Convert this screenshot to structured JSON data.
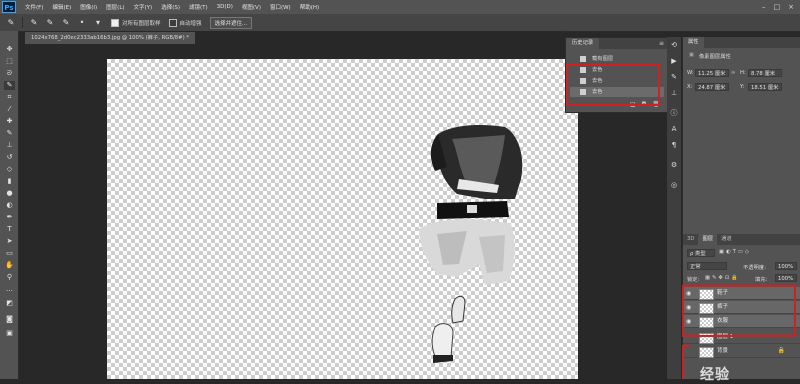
{
  "menubar": {
    "logo": "Ps",
    "items": [
      "文件(F)",
      "编辑(E)",
      "图像(I)",
      "图层(L)",
      "文字(Y)",
      "选择(S)",
      "滤镜(T)",
      "3D(D)",
      "视图(V)",
      "窗口(W)",
      "帮助(H)"
    ],
    "win_controls": [
      "–",
      "□",
      "×"
    ]
  },
  "options": {
    "sample_all_layers": "对所有图层取样",
    "auto_enhance": "自动增强",
    "select_subject": "选择并遮住..."
  },
  "document": {
    "tab_title": "1024x768_2d0ec2333ab16b3.jpg @ 100% (裤子, RGB/8#) *"
  },
  "history": {
    "title": "历史记录",
    "items": [
      {
        "label": "载有图层",
        "active": false
      },
      {
        "label": "去色",
        "active": false
      },
      {
        "label": "去色",
        "active": false
      },
      {
        "label": "去色",
        "active": true
      }
    ],
    "footer_icons": [
      "⬓",
      "◘",
      "🗑"
    ]
  },
  "properties": {
    "title": "属性",
    "subtitle": "像素图层属性",
    "w_label": "W:",
    "w_value": "11.25 厘米",
    "h_label": "H:",
    "h_value": "8.78 厘米",
    "x_label": "X:",
    "x_value": "24.87 厘米",
    "y_label": "Y:",
    "y_value": "18.51 厘米"
  },
  "layers": {
    "tabs": [
      "3D",
      "图层",
      "通道"
    ],
    "filter_label": "ρ 类型",
    "blend_mode": "正常",
    "opacity_label": "不透明度:",
    "opacity_value": "100%",
    "lock_label": "锁定:",
    "fill_label": "填充:",
    "fill_value": "100%",
    "items": [
      {
        "name": "鞋子",
        "visible": true,
        "selected": true,
        "locked": false
      },
      {
        "name": "裤子",
        "visible": true,
        "selected": true,
        "locked": false
      },
      {
        "name": "衣服",
        "visible": true,
        "selected": true,
        "locked": false
      },
      {
        "name": "图层 1",
        "visible": false,
        "selected": false,
        "locked": false
      },
      {
        "name": "背景",
        "visible": false,
        "selected": false,
        "locked": true
      }
    ]
  },
  "watermark": "经验",
  "colors": {
    "highlight_box": "#d11f22",
    "ui_gray": "#535353"
  }
}
